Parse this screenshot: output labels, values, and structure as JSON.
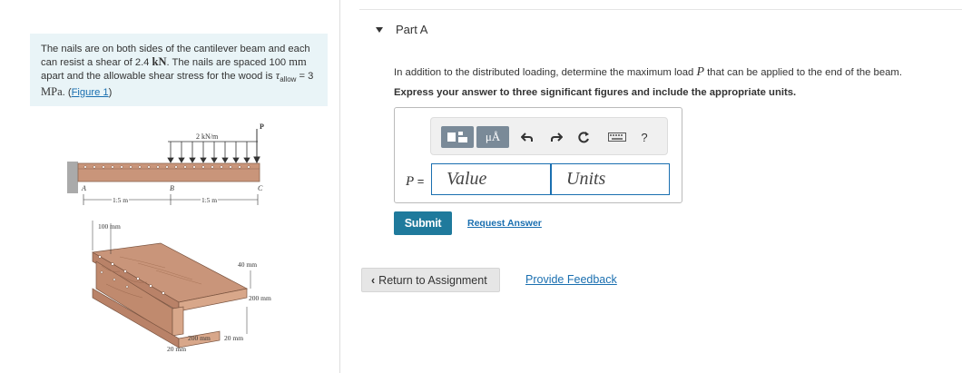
{
  "problem": {
    "text_before_shear": "The nails are on both sides of the cantilever beam and each can resist a shear of 2.4 ",
    "shear_unit": "kN",
    "text_spacing": ". The nails are spaced 100 ",
    "spacing_unit": "mm",
    "text_stress": " apart and the allowable shear stress for the wood is ",
    "tau_symbol": "τ",
    "tau_sub": "allow",
    "tau_value": " = 3 ",
    "tau_unit": "MPa",
    "period": ". ",
    "figure_link": "Figure 1"
  },
  "figure": {
    "load_label": "2 kN/m",
    "point_load_label": "P",
    "point_a": "A",
    "point_b": "B",
    "point_c": "C",
    "span1": "1.5 m",
    "span2": "1.5 m",
    "nail_spacing": "100 mm",
    "flange_thickness": "40 mm",
    "web_depth": "200 mm",
    "flange_width": "200 mm",
    "web_thickness": "20 mm",
    "bottom_thickness": "20 mm",
    "wood_color": "#c9957a"
  },
  "part": {
    "title": "Part A",
    "question_before": "In addition to the distributed loading, determine the maximum load ",
    "question_var": "P",
    "question_after": " that can be applied to the end of the beam.",
    "instruction": "Express your answer to three significant figures and include the appropriate units."
  },
  "answer": {
    "var_label": "P",
    "equals": " =",
    "value_placeholder": "Value",
    "units_placeholder": "Units",
    "toolbar": {
      "units_label": "μÅ",
      "help_label": "?",
      "icons": [
        "templates-icon",
        "units-icon",
        "undo-icon",
        "redo-icon",
        "reset-icon",
        "keyboard-icon",
        "help-icon"
      ]
    }
  },
  "actions": {
    "submit": "Submit",
    "request_answer": "Request Answer",
    "return": "Return to Assignment",
    "feedback": "Provide Feedback"
  },
  "colors": {
    "accent": "#1f7a9c",
    "link": "#1a6fb0",
    "problem_bg": "#e9f4f7"
  }
}
